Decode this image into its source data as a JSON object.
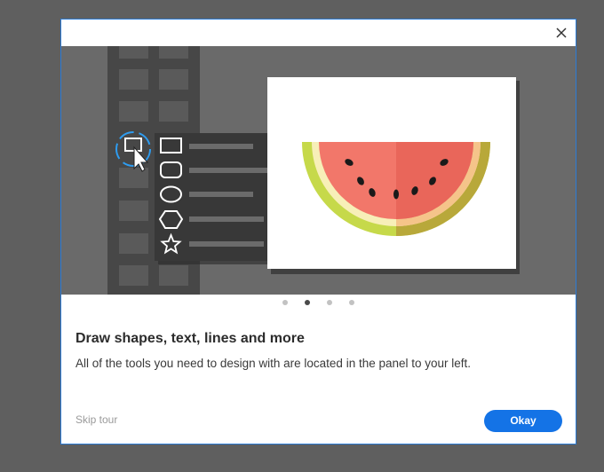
{
  "dialog": {
    "title": "Draw shapes, text, lines and more",
    "description": "All of the tools you need to design with are located in the panel to your left.",
    "skip_label": "Skip tour",
    "okay_label": "Okay",
    "close_icon": "close-icon"
  },
  "pager": {
    "total": 4,
    "active_index": 1
  },
  "illustration": {
    "tools": [
      "rectangle-icon",
      "rounded-rectangle-icon",
      "ellipse-icon",
      "polygon-icon",
      "star-icon"
    ],
    "artwork": "watermelon-slice",
    "colors": {
      "background": "#6a6a6a",
      "toolbar": "#474747",
      "flyout": "#383838",
      "selection_ring": "#2e9cf0",
      "melon_flesh": "#f2776a",
      "melon_rind": "#c6d94a"
    }
  },
  "colors": {
    "accent": "#1473e6",
    "dialog_border": "#2b7bd6",
    "backdrop": "#5f5f5f"
  }
}
